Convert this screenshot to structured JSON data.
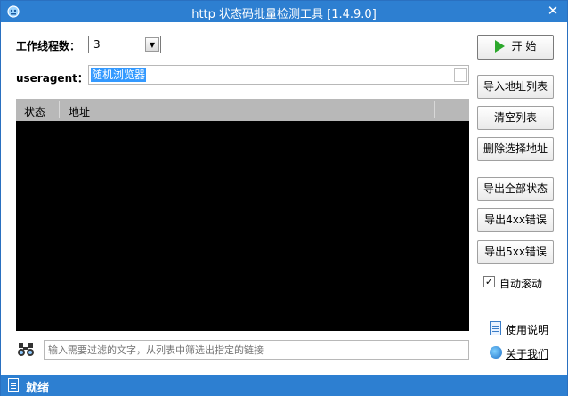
{
  "window": {
    "title": "http 状态码批量检测工具  [1.4.9.0]"
  },
  "form": {
    "threads_label": "工作线程数：",
    "threads_value": "3",
    "useragent_label": "useragent：",
    "useragent_value": "随机浏览器"
  },
  "table": {
    "columns": [
      "状态",
      "地址"
    ]
  },
  "buttons": {
    "start": "开 始",
    "import": "导入地址列表",
    "clear": "清空列表",
    "delete_selected": "删除选择地址",
    "export_all": "导出全部状态",
    "export_4xx": "导出4xx错误",
    "export_5xx": "导出5xx错误"
  },
  "options": {
    "auto_scroll_label": "自动滚动",
    "auto_scroll_checked": true
  },
  "links": {
    "manual": "使用说明",
    "about": "关于我们"
  },
  "filter": {
    "placeholder": "输入需要过滤的文字，从列表中筛选出指定的链接"
  },
  "status": {
    "text": "就绪"
  },
  "colors": {
    "accent": "#2d7fd1",
    "list_bg": "#000000",
    "header_bg": "#b8b8b8",
    "play": "#2ca82c",
    "selection": "#3399ff"
  }
}
